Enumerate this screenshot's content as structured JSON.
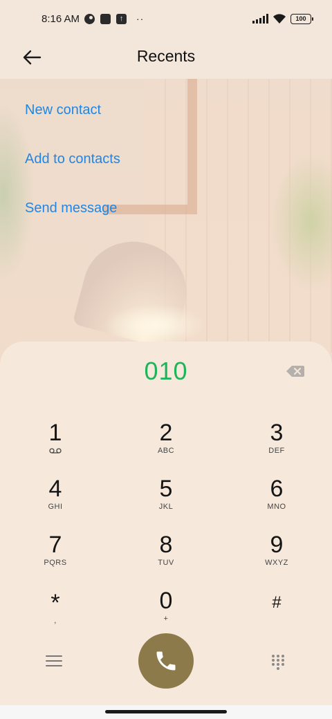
{
  "status_bar": {
    "time": "8:16 AM",
    "dots": "··",
    "battery": "100"
  },
  "header": {
    "title": "Recents",
    "back_icon": "arrow-left-icon"
  },
  "actions": [
    {
      "label": "New contact"
    },
    {
      "label": "Add to contacts"
    },
    {
      "label": "Send message"
    }
  ],
  "dialer": {
    "number": "010",
    "keys": [
      {
        "digit": "1",
        "letters": ""
      },
      {
        "digit": "2",
        "letters": "ABC"
      },
      {
        "digit": "3",
        "letters": "DEF"
      },
      {
        "digit": "4",
        "letters": "GHI"
      },
      {
        "digit": "5",
        "letters": "JKL"
      },
      {
        "digit": "6",
        "letters": "MNO"
      },
      {
        "digit": "7",
        "letters": "PQRS"
      },
      {
        "digit": "8",
        "letters": "TUV"
      },
      {
        "digit": "9",
        "letters": "WXYZ"
      },
      {
        "digit": "*",
        "letters": ","
      },
      {
        "digit": "0",
        "letters": "+"
      },
      {
        "digit": "#",
        "letters": ""
      }
    ]
  },
  "colors": {
    "accent_link": "#1f86e6",
    "number_green": "#1fb45a",
    "call_button": "#8c7a4a",
    "panel_bg": "#f6e8db"
  }
}
